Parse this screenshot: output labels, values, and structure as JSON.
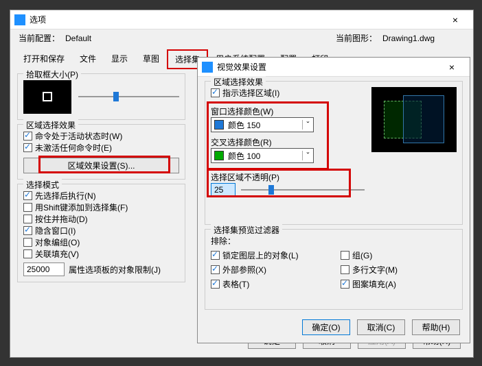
{
  "main": {
    "title": "选项",
    "config_label": "当前配置：",
    "config_value": "Default",
    "drawing_label": "当前图形：",
    "drawing_value": "Drawing1.dwg",
    "tabs": [
      "打开和保存",
      "文件",
      "显示",
      "草图",
      "选择集",
      "用户系统配置",
      "配置",
      "打印"
    ],
    "pickbox_title": "拾取框大小(P)",
    "region_title": "区域选择效果",
    "cb_active": "命令处于活动状态时(W)",
    "cb_noactive": "未激活任何命令时(E)",
    "region_btn": "区域效果设置(S)...",
    "mode_title": "选择模式",
    "cb_first": "先选择后执行(N)",
    "cb_shift": "用Shift键添加到选择集(F)",
    "cb_drag": "按住并拖动(D)",
    "cb_implied": "隐含窗口(I)",
    "cb_group": "对象编组(O)",
    "cb_hatch": "关联填充(V)",
    "limit_val": "25000",
    "limit_label": "属性选项板的对象限制(J)",
    "ok": "确定",
    "cancel": "取消",
    "apply": "应用(A)",
    "help": "帮助(H)"
  },
  "vfx": {
    "title": "视觉效果设置",
    "region_title": "区域选择效果",
    "cb_region": "指示选择区域(I)",
    "win_color_lbl": "窗口选择颜色(W)",
    "win_color_txt": "颜色 150",
    "cross_color_lbl": "交叉选择颜色(R)",
    "cross_color_txt": "颜色 100",
    "opacity_lbl": "选择区域不透明(P)",
    "opacity_val": "25",
    "filter_title": "选择集预览过滤器",
    "exclude": "排除：",
    "cb_lock": "锁定图层上的对象(L)",
    "cb_group": "组(G)",
    "cb_xref": "外部参照(X)",
    "cb_mtext": "多行文字(M)",
    "cb_table": "表格(T)",
    "cb_fill": "图案填充(A)",
    "ok": "确定(O)",
    "cancel": "取消(C)",
    "help": "帮助(H)"
  }
}
